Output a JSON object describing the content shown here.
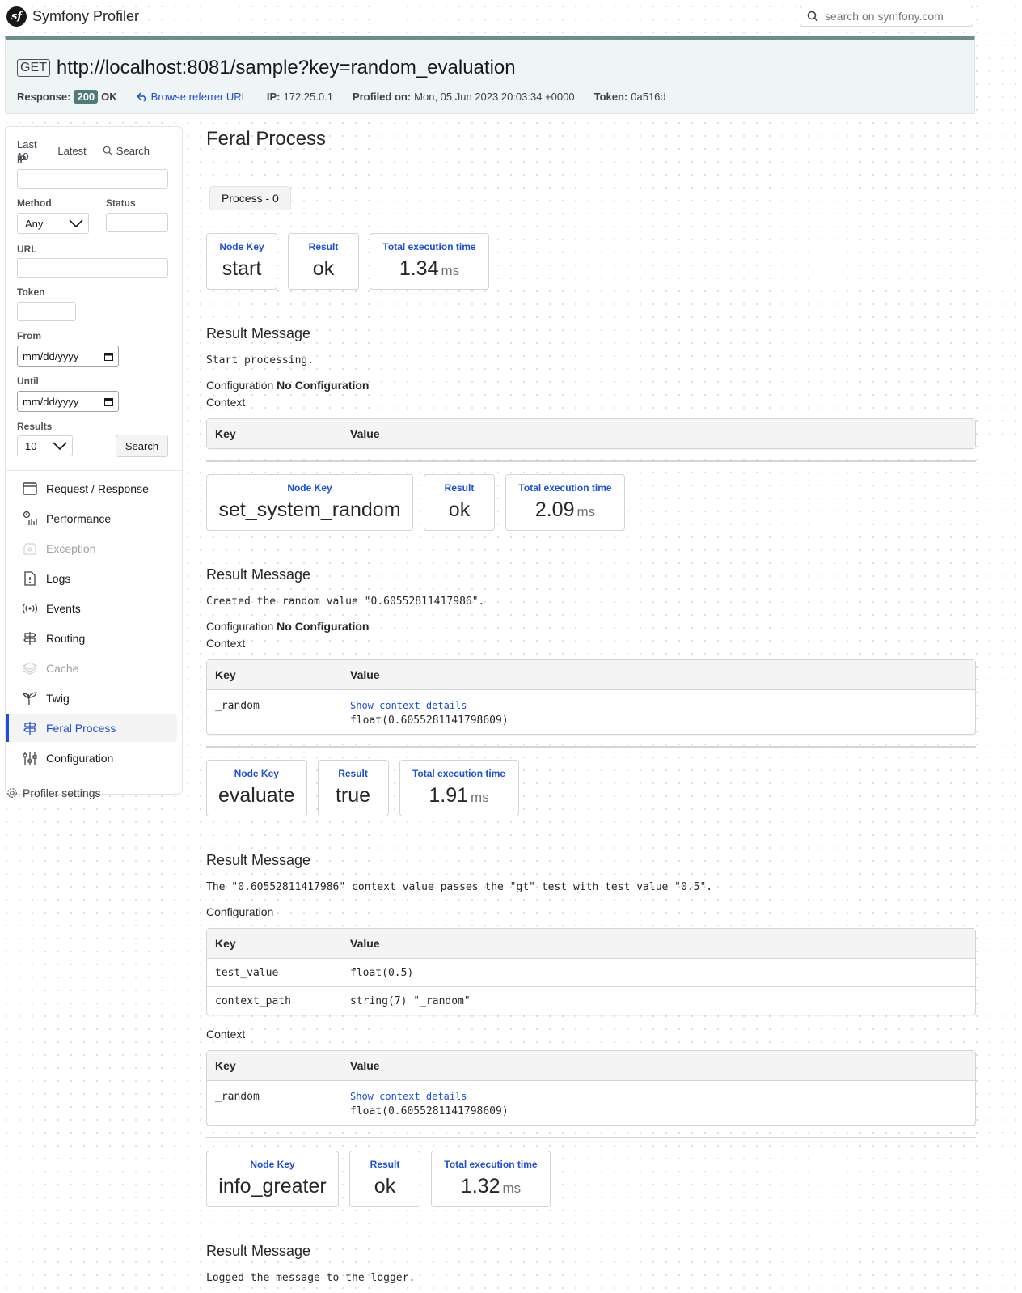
{
  "header": {
    "brand_logo": "sf",
    "brand_name": "Symfony Profiler",
    "search_placeholder": "search on symfony.com"
  },
  "summary": {
    "method": "GET",
    "url": "http://localhost:8081/sample?key=random_evaluation",
    "response_label": "Response:",
    "status_code": "200",
    "status_text": "OK",
    "referrer_link": "Browse referrer URL",
    "ip_label": "IP:",
    "ip": "172.25.0.1",
    "profiled_label": "Profiled on:",
    "profiled_on": "Mon, 05 Jun 2023 20:03:34 +0000",
    "token_label": "Token:",
    "token": "0a516d",
    "accent_color": "#6b8e8a"
  },
  "sidebar": {
    "tabs": {
      "last10": "Last 10",
      "latest": "Latest",
      "search": "Search"
    },
    "form": {
      "ip_label": "IP",
      "method_label": "Method",
      "method_value": "Any",
      "status_label": "Status",
      "url_label": "URL",
      "token_label": "Token",
      "from_label": "From",
      "from_value": "mm/dd/yyyy",
      "until_label": "Until",
      "until_value": "mm/dd/yyyy",
      "results_label": "Results",
      "results_value": "10",
      "search_button": "Search"
    },
    "nav": [
      {
        "label": "Request / Response",
        "icon": "request-icon"
      },
      {
        "label": "Performance",
        "icon": "performance-icon"
      },
      {
        "label": "Exception",
        "icon": "exception-icon"
      },
      {
        "label": "Logs",
        "icon": "logs-icon"
      },
      {
        "label": "Events",
        "icon": "events-icon"
      },
      {
        "label": "Routing",
        "icon": "routing-icon"
      },
      {
        "label": "Cache",
        "icon": "cache-icon"
      },
      {
        "label": "Twig",
        "icon": "twig-icon"
      },
      {
        "label": "Feral Process",
        "icon": "feral-icon"
      },
      {
        "label": "Configuration",
        "icon": "configuration-icon"
      }
    ],
    "settings": "Profiler settings"
  },
  "main": {
    "title": "Feral Process",
    "process_tab": "Process - 0",
    "labels": {
      "node_key": "Node Key",
      "result": "Result",
      "total_time": "Total execution time",
      "unit": "ms",
      "result_message": "Result Message",
      "configuration": "Configuration",
      "no_configuration": "No Configuration",
      "context": "Context",
      "key": "Key",
      "value": "Value",
      "show_details": "Show context details"
    },
    "steps": [
      {
        "node_key": "start",
        "result": "ok",
        "time": "1.34",
        "message": "Start processing.",
        "context": []
      },
      {
        "node_key": "set_system_random",
        "result": "ok",
        "time": "2.09",
        "message": "Created the random value \"0.60552811417986\".",
        "context": [
          {
            "key": "_random",
            "value": "float(0.6055281141798609)"
          }
        ]
      },
      {
        "node_key": "evaluate",
        "result": "true",
        "time": "1.91",
        "message": "The \"0.60552811417986\" context value passes the \"gt\" test with test value \"0.5\".",
        "configuration": [
          {
            "key": "test_value",
            "value": "float(0.5)"
          },
          {
            "key": "context_path",
            "value": "string(7) \"_random\""
          }
        ],
        "context": [
          {
            "key": "_random",
            "value": "float(0.6055281141798609)"
          }
        ]
      },
      {
        "node_key": "info_greater",
        "result": "ok",
        "time": "1.32",
        "message": "Logged the message to the logger."
      }
    ]
  }
}
